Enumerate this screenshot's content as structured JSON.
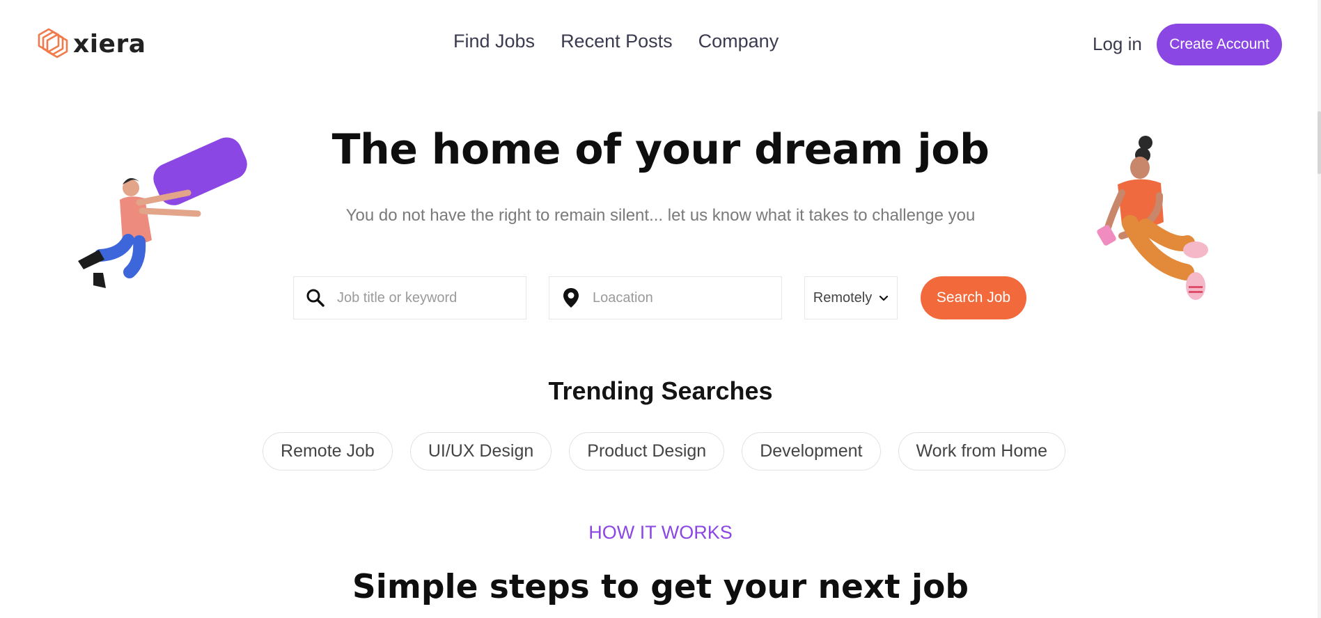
{
  "brand": {
    "name": "xiera",
    "logo_icon": "hexagon-stack-icon",
    "accent_color": "#8b47e3",
    "cta_color": "#f26a3b",
    "logo_color": "#f27a4a"
  },
  "nav": {
    "items": [
      {
        "label": "Find Jobs"
      },
      {
        "label": "Recent Posts"
      },
      {
        "label": "Company"
      }
    ],
    "login_label": "Log in",
    "create_account_label": "Create Account"
  },
  "hero": {
    "title": "The home of your dream job",
    "subtitle": "You do not have the right to remain silent... let us know what it takes to challenge you"
  },
  "search": {
    "keyword_placeholder": "Job title or keyword",
    "keyword_icon": "search-icon",
    "location_placeholder": "Loacation",
    "location_icon": "map-pin-icon",
    "work_type_selected": "Remotely",
    "work_type_icon": "chevron-down-icon",
    "button_label": "Search Job"
  },
  "trending": {
    "title": "Trending Searches",
    "chips": [
      {
        "label": "Remote Job"
      },
      {
        "label": "UI/UX Design"
      },
      {
        "label": "Product Design"
      },
      {
        "label": "Development"
      },
      {
        "label": "Work from Home"
      }
    ]
  },
  "how_it_works": {
    "label": "HOW IT WORKS",
    "title": "Simple steps to get your next job"
  }
}
